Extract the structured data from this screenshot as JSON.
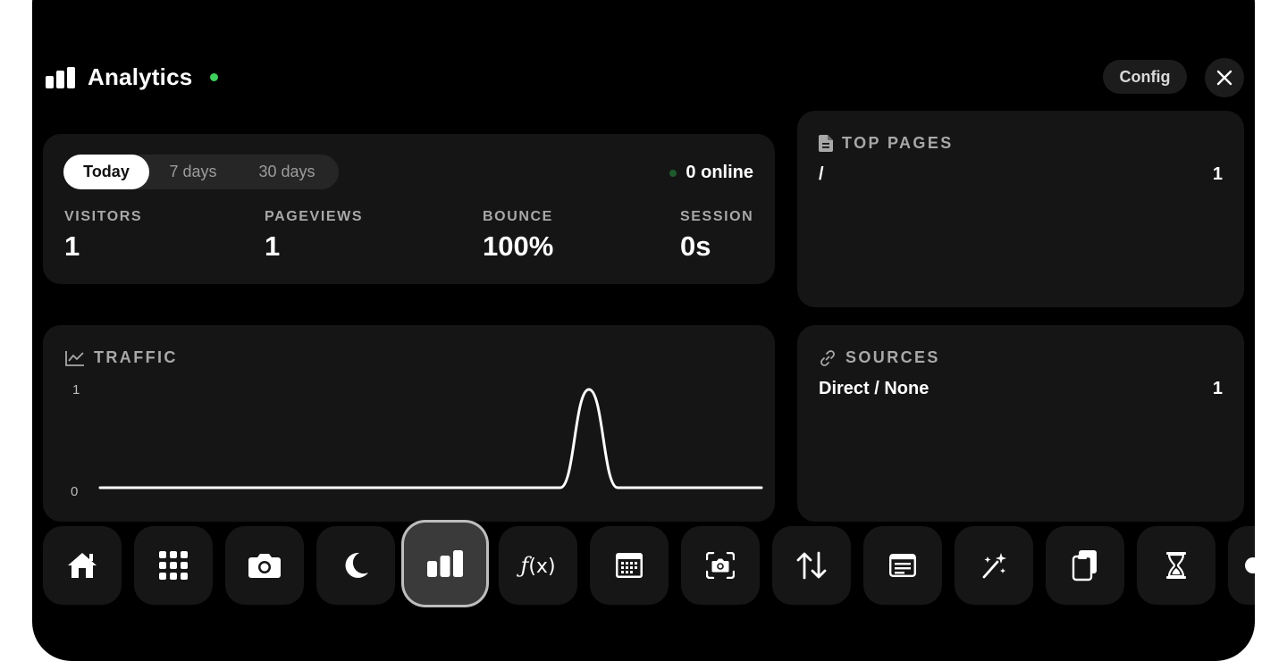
{
  "header": {
    "title": "Analytics",
    "config_label": "Config"
  },
  "range_tabs": [
    {
      "label": "Today",
      "active": true
    },
    {
      "label": "7 days",
      "active": false
    },
    {
      "label": "30 days",
      "active": false
    }
  ],
  "online": {
    "label": "0 online"
  },
  "stats": [
    {
      "label": "VISITORS",
      "value": "1"
    },
    {
      "label": "PAGEVIEWS",
      "value": "1"
    },
    {
      "label": "BOUNCE",
      "value": "100%"
    },
    {
      "label": "SESSION",
      "value": "0s"
    }
  ],
  "top_pages": {
    "title": "TOP PAGES",
    "rows": [
      {
        "path": "/",
        "count": "1"
      }
    ]
  },
  "sources": {
    "title": "SOURCES",
    "rows": [
      {
        "name": "Direct / None",
        "count": "1"
      }
    ]
  },
  "traffic": {
    "title": "TRAFFIC",
    "y_max_label": "1",
    "y_min_label": "0"
  },
  "chart_data": {
    "type": "line",
    "title": "TRAFFIC",
    "xlabel": "",
    "ylabel": "",
    "ylim": [
      0,
      1
    ],
    "y_ticks": [
      "0",
      "1"
    ],
    "x": [
      0,
      1,
      2,
      3,
      4,
      5,
      6,
      7,
      8,
      9,
      10,
      11,
      12,
      13,
      14,
      15,
      16,
      17,
      18,
      19,
      20,
      21,
      22,
      23
    ],
    "series": [
      {
        "values": [
          0,
          0,
          0,
          0,
          0,
          0,
          0,
          0,
          0,
          0,
          0,
          0,
          0,
          0,
          0,
          0,
          0,
          1,
          0,
          0,
          0,
          0,
          0,
          0
        ]
      }
    ],
    "grid": false,
    "legend": "none",
    "color": "#ffffff"
  },
  "dock": {
    "items": [
      {
        "icon": "home-icon",
        "active": false
      },
      {
        "icon": "apps-grid-icon",
        "active": false
      },
      {
        "icon": "camera-icon",
        "active": false
      },
      {
        "icon": "moon-icon",
        "active": false
      },
      {
        "icon": "bar-chart-icon",
        "active": true
      },
      {
        "icon": "function-icon",
        "active": false
      },
      {
        "icon": "calendar-icon",
        "active": false
      },
      {
        "icon": "screenshot-icon",
        "active": false
      },
      {
        "icon": "arrows-up-down-icon",
        "active": false
      },
      {
        "icon": "message-icon",
        "active": false
      },
      {
        "icon": "magic-wand-icon",
        "active": false
      },
      {
        "icon": "clipboard-icon",
        "active": false
      },
      {
        "icon": "hourglass-icon",
        "active": false
      }
    ]
  }
}
